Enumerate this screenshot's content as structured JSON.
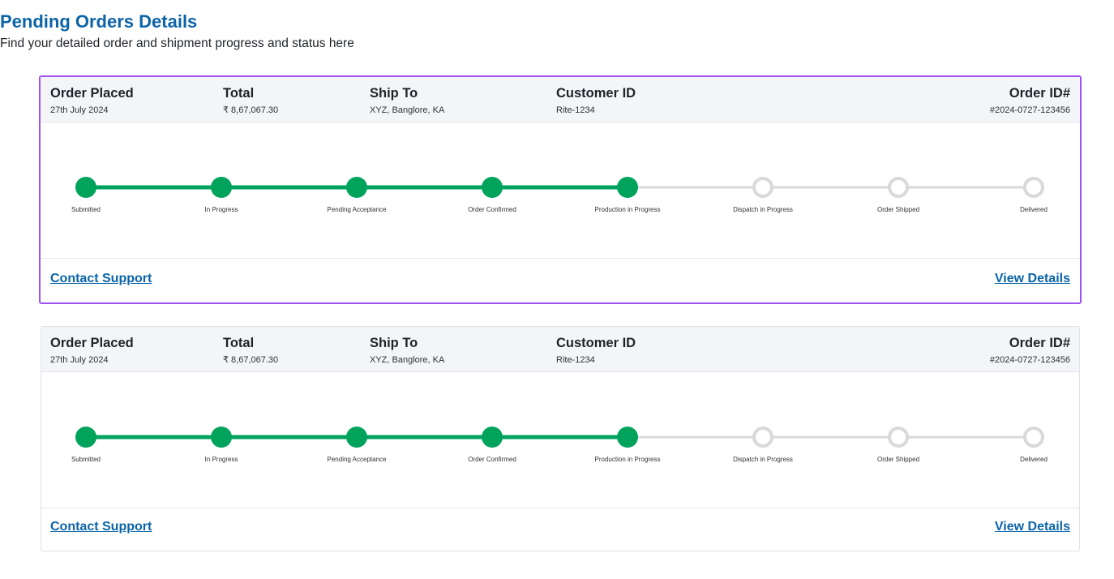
{
  "page": {
    "title": "Pending Orders Details",
    "subtitle": "Find your detailed order and shipment progress and status here"
  },
  "colors": {
    "title": "#0b64a8",
    "complete": "#00a35c",
    "pending": "#d9d9d9",
    "selected_border": "#a052f0"
  },
  "orders": [
    {
      "order_placed_label": "Order Placed",
      "order_placed": "27th July 2024",
      "total_label": "Total",
      "total": "₹ 8,67,067.30",
      "ship_to_label": "Ship To",
      "ship_to": "XYZ, Banglore, KA",
      "customer_id_label": "Customer ID",
      "customer_id": "Rite-1234",
      "order_id_label": "Order ID#",
      "order_id": "#2024-0727-123456",
      "completed_steps": 5,
      "steps": [
        "Submitted",
        "In Progress",
        "Pending Acceptance",
        "Order Confirmed",
        "Production in Progress",
        "Dispatch in Progress",
        "Order Shipped",
        "Delivered"
      ],
      "contact_support": "Contact Support",
      "view_details": "View Details",
      "selected": true
    },
    {
      "order_placed_label": "Order Placed",
      "order_placed": "27th July 2024",
      "total_label": "Total",
      "total": "₹ 8,67,067.30",
      "ship_to_label": "Ship To",
      "ship_to": "XYZ, Banglore, KA",
      "customer_id_label": "Customer ID",
      "customer_id": "Rite-1234",
      "order_id_label": "Order ID#",
      "order_id": "#2024-0727-123456",
      "completed_steps": 5,
      "steps": [
        "Submitted",
        "In Progress",
        "Pending Acceptance",
        "Order Confirmed",
        "Production in Progress",
        "Dispatch in Progress",
        "Order Shipped",
        "Delivered"
      ],
      "contact_support": "Contact Support",
      "view_details": "View Details",
      "selected": false
    }
  ]
}
